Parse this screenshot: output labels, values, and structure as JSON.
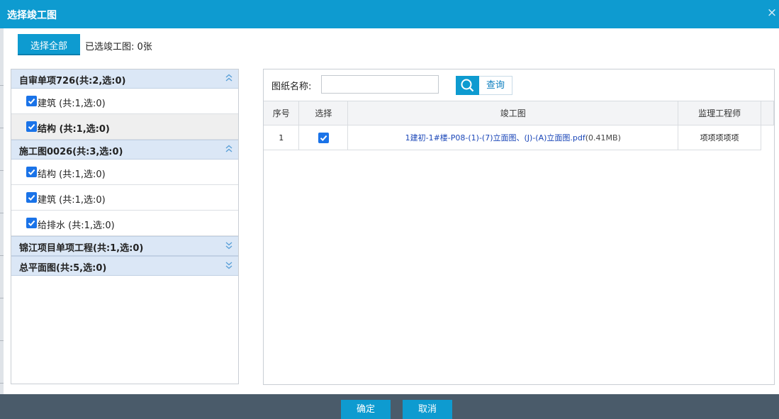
{
  "dialog": {
    "title": "选择竣工图",
    "close_glyph": "×"
  },
  "toolbar": {
    "select_all_label": "选择全部",
    "selected_count_text": "已选竣工图: 0张"
  },
  "groups": [
    {
      "label": "自审单项726(共:2,选:0)",
      "expanded": true,
      "items": [
        {
          "label": "建筑 (共:1,选:0)",
          "checked": true,
          "selected": false
        },
        {
          "label": "结构 (共:1,选:0)",
          "checked": true,
          "selected": true
        }
      ]
    },
    {
      "label": "施工图0026(共:3,选:0)",
      "expanded": true,
      "items": [
        {
          "label": "结构 (共:1,选:0)",
          "checked": true,
          "selected": false
        },
        {
          "label": "建筑 (共:1,选:0)",
          "checked": true,
          "selected": false
        },
        {
          "label": "给排水 (共:1,选:0)",
          "checked": true,
          "selected": false
        }
      ]
    },
    {
      "label": "锦江项目单项工程(共:1,选:0)",
      "expanded": false,
      "items": []
    },
    {
      "label": "总平面图(共:5,选:0)",
      "expanded": false,
      "items": []
    }
  ],
  "search": {
    "label": "图纸名称:",
    "value": "",
    "placeholder": "",
    "button_label": "查询"
  },
  "table": {
    "headers": [
      "序号",
      "选择",
      "竣工图",
      "监理工程师"
    ],
    "rows": [
      {
        "index": "1",
        "checked": true,
        "file_name": "1建初-1#楼-P08-(1)-(7)立面图、(J)-(A)立面图.pdf",
        "file_size": "(0.41MB)",
        "engineer": "项项项项项"
      }
    ]
  },
  "footer": {
    "confirm_label": "确定",
    "cancel_label": "取消"
  },
  "colors": {
    "accent": "#0e9bd0",
    "group_header": "#dbe7f6",
    "footer_bar": "#4a5b6a",
    "checkbox": "#1a73e8",
    "link": "#1a46b8"
  }
}
